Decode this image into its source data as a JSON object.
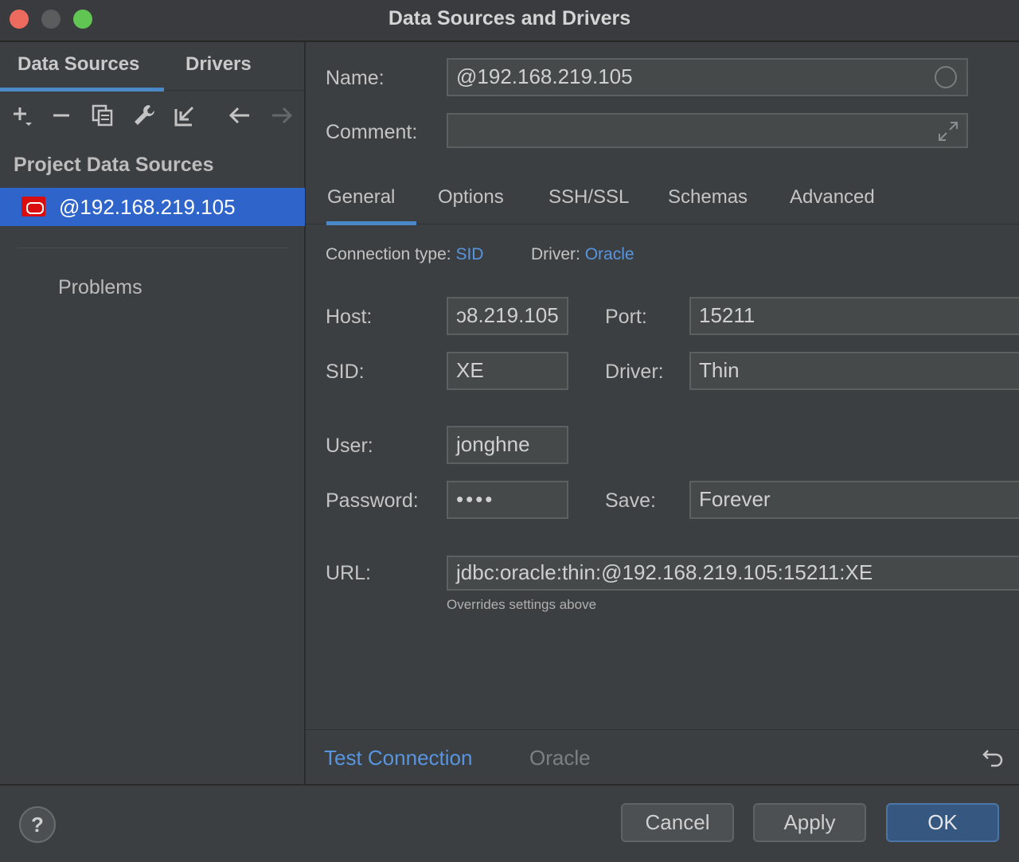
{
  "window": {
    "title": "Data Sources and Drivers"
  },
  "left_panel": {
    "tabs": [
      {
        "label": "Data Sources",
        "active": true
      },
      {
        "label": "Drivers",
        "active": false
      }
    ],
    "toolbar_icons": [
      "add-icon",
      "remove-icon",
      "duplicate-icon",
      "wrench-icon",
      "import-icon",
      "back-arrow-icon",
      "forward-arrow-icon"
    ],
    "section_title": "Project Data Sources",
    "data_sources": [
      {
        "name": "@192.168.219.105",
        "icon": "oracle-icon",
        "selected": true
      }
    ],
    "problems_label": "Problems"
  },
  "form": {
    "name_label": "Name:",
    "name_value": "@192.168.219.105",
    "comment_label": "Comment:",
    "comment_value": "",
    "tabs": [
      {
        "label": "General",
        "active": true
      },
      {
        "label": "Options",
        "active": false
      },
      {
        "label": "SSH/SSL",
        "active": false
      },
      {
        "label": "Schemas",
        "active": false
      },
      {
        "label": "Advanced",
        "active": false
      }
    ],
    "connection_type_label": "Connection type:",
    "connection_type_value": "SID",
    "driver_info_label": "Driver:",
    "driver_info_value": "Oracle",
    "host_label": "Host:",
    "host_value": "ɔ8.219.105",
    "port_label": "Port:",
    "port_value": "15211",
    "sid_label": "SID:",
    "sid_value": "XE",
    "driver_label": "Driver:",
    "driver_value": "Thin",
    "user_label": "User:",
    "user_value": "jonghne",
    "password_label": "Password:",
    "password_value": "••••",
    "save_label": "Save:",
    "save_value": "Forever",
    "url_label": "URL:",
    "url_value": "jdbc:oracle:thin:@192.168.219.105:15211:XE",
    "url_hint": "Overrides settings above",
    "test_connection": "Test Connection",
    "driver_footer": "Oracle"
  },
  "footer": {
    "help": "?",
    "cancel": "Cancel",
    "apply": "Apply",
    "ok": "OK"
  },
  "colors": {
    "accent": "#4a88c7",
    "link": "#5895e0",
    "selection": "#2f65ca",
    "ok_button": "#365880"
  }
}
